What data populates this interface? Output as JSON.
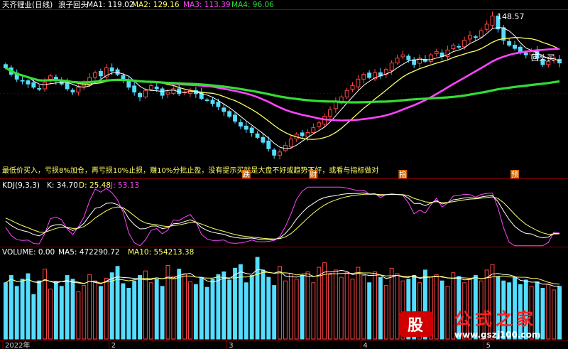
{
  "header": {
    "stock": "天齐锂业(日线)",
    "indicator": "浪子回头",
    "ma_items": [
      {
        "label": "MA1: 119.02",
        "color": "#ffffff"
      },
      {
        "label": "MA2: 129.16",
        "color": "#ffff66"
      },
      {
        "label": "MA3: 113.39",
        "color": "#ff44ff"
      },
      {
        "label": "MA4: 96.06",
        "color": "#33dd33"
      }
    ]
  },
  "price_panel": {
    "peak_label": "148.57",
    "buy_label": "回头买",
    "low_label": "",
    "strategy_text": "最低价买入，亏损8%加仓，再亏损10%止损，赚10%分批止盈，没有提示买就是大盘不好或趋势不好，或看与指标做对",
    "event_tags": [
      "跌",
      "财",
      "指",
      "预"
    ]
  },
  "kdj_panel": {
    "title": "KDJ(9,3,3)",
    "k_label": "K: 34.70",
    "d_label": "D: 25.48",
    "j_label": "J: 53.13"
  },
  "volume_panel": {
    "title": "VOLUME: 0.00",
    "ma5_label": "MA5: 472290.72",
    "ma10_label": "MA10: 554213.38"
  },
  "time_axis": [
    "2022年",
    "2",
    "3",
    "4",
    "5"
  ],
  "watermark": {
    "logo_char": "股",
    "brand": "公式之家",
    "url": "www.gszj100.com"
  },
  "colors": {
    "up": "#ff4444",
    "down": "#55ddff",
    "ma1": "#ffffff",
    "ma2": "#ffff66",
    "ma3": "#ff44ff",
    "ma4": "#33dd33",
    "kdj_k": "#ffffff",
    "kdj_d": "#ffff66",
    "kdj_j": "#ff44ff",
    "grid": "#8b0000"
  },
  "chart_data": {
    "type": "candlestick",
    "y_range": [
      56,
      150
    ],
    "peak_price": 148.57,
    "closes": [
      116,
      112,
      109,
      108,
      106,
      104,
      103,
      107,
      111,
      108,
      106,
      103,
      101,
      104,
      106,
      110,
      113,
      111,
      116,
      114,
      112,
      108,
      104,
      101,
      98,
      102,
      105,
      103,
      99,
      101,
      103,
      100,
      101,
      102,
      100,
      97,
      96,
      94,
      92,
      89,
      86,
      83,
      80,
      78,
      76,
      73,
      70,
      66,
      62,
      64,
      68,
      72,
      75,
      74,
      76,
      79,
      82,
      86,
      90,
      95,
      98,
      102,
      105,
      109,
      112,
      110,
      113,
      111,
      115,
      119,
      122,
      124,
      121,
      118,
      122,
      120,
      124,
      126,
      123,
      127,
      130,
      129,
      133,
      136,
      135,
      139,
      143,
      148,
      140,
      133,
      130,
      128,
      126,
      124,
      126,
      122,
      118,
      120,
      122,
      119
    ],
    "volumes": [
      62,
      70,
      58,
      66,
      72,
      49,
      64,
      77,
      55,
      63,
      58,
      70,
      66,
      52,
      59,
      71,
      64,
      58,
      67,
      73,
      80,
      61,
      56,
      64,
      70,
      75,
      62,
      66,
      58,
      81,
      69,
      77,
      72,
      63,
      60,
      68,
      57,
      66,
      71,
      74,
      65,
      78,
      82,
      62,
      70,
      90,
      76,
      68,
      59,
      80,
      64,
      72,
      66,
      70,
      74,
      62,
      79,
      84,
      71,
      76,
      68,
      73,
      66,
      79,
      70,
      62,
      74,
      68,
      59,
      78,
      72,
      64,
      66,
      70,
      62,
      76,
      68,
      71,
      64,
      58,
      73,
      69,
      62,
      66,
      70,
      64,
      76,
      82,
      69,
      64,
      62,
      68,
      60,
      65,
      58,
      63,
      56,
      60,
      54,
      58
    ]
  }
}
